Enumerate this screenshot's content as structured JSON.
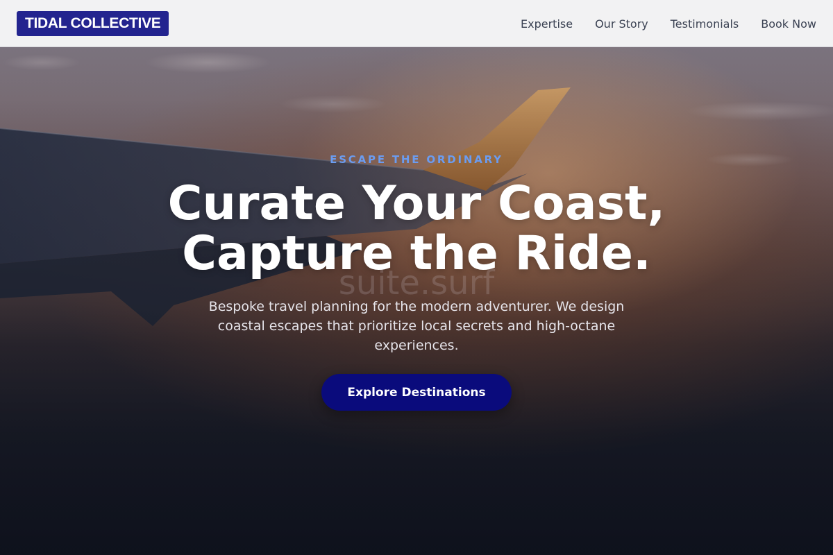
{
  "header": {
    "logo_text": "TIDAL COLLECTIVE",
    "nav": [
      {
        "label": "Expertise"
      },
      {
        "label": "Our Story"
      },
      {
        "label": "Testimonials"
      },
      {
        "label": "Book Now"
      }
    ]
  },
  "hero": {
    "eyebrow": "ESCAPE THE ORDINARY",
    "headline_line1": "Curate Your Coast,",
    "headline_line2": "Capture the Ride.",
    "watermark": "suite.surf",
    "subtext": "Bespoke travel planning for the modern adventurer. We design coastal escapes that prioritize local secrets and high-octane experiences.",
    "cta_label": "Explore Destinations"
  },
  "colors": {
    "logo_bg": "#23248f",
    "eyebrow": "#6b9cf0",
    "cta_bg": "#0a0b7c",
    "header_bg": "#f6f6f7"
  }
}
